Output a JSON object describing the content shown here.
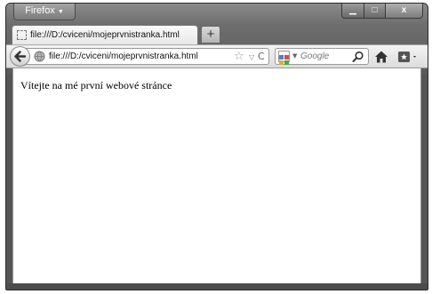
{
  "window": {
    "app_button": "Firefox",
    "app_button_arrow": "▼",
    "controls": {
      "minimize": "▁",
      "maximize": "□",
      "close": "x"
    }
  },
  "tabs": [
    {
      "label": "file:///D:/cviceni/mojeprvnistranka.html",
      "icon": "page-icon"
    }
  ],
  "new_tab_label": "+",
  "navbar": {
    "url": "file:///D:/cviceni/mojeprvnistranka.html",
    "bookmark_star": "☆",
    "dropdown": "▽",
    "reload": "C",
    "search_placeholder": "Google",
    "search_engine_arrow": "▼"
  },
  "page": {
    "text": "Vítejte na mé první webové stránce"
  }
}
